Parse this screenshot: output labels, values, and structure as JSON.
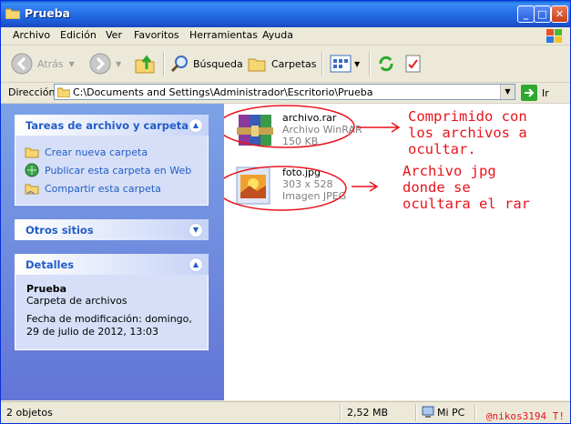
{
  "window": {
    "title": "Prueba"
  },
  "menu": [
    "Archivo",
    "Edición",
    "Ver",
    "Favoritos",
    "Herramientas",
    "Ayuda"
  ],
  "toolbar": {
    "back": "Atrás",
    "search": "Búsqueda",
    "folders": "Carpetas"
  },
  "address": {
    "label": "Dirección",
    "path": "C:\\Documents and Settings\\Administrador\\Escritorio\\Prueba",
    "go": "Ir"
  },
  "tasks_panel": {
    "title": "Tareas de archivo y carpeta",
    "items": [
      "Crear nueva carpeta",
      "Publicar esta carpeta en Web",
      "Compartir esta carpeta"
    ]
  },
  "other_places": {
    "title": "Otros sitios"
  },
  "details": {
    "title": "Detalles",
    "name": "Prueba",
    "type": "Carpeta de archivos",
    "modified": "Fecha de modificación: domingo, 29 de julio de 2012, 13:03"
  },
  "files": [
    {
      "name": "archivo.rar",
      "line2": "Archivo WinRAR",
      "line3": "150 KB"
    },
    {
      "name": "foto.jpg",
      "line2": "303 x 528",
      "line3": "Imagen JPEG"
    }
  ],
  "annotations": {
    "rar": [
      "Comprimido con",
      "los archivos a",
      "ocultar."
    ],
    "jpg": [
      "Archivo jpg",
      "donde se",
      "ocultara el rar"
    ]
  },
  "status": {
    "count": "2 objetos",
    "size": "2,52 MB",
    "location": "Mi PC",
    "watermark": "@nikos3194 T!"
  },
  "colors": {
    "title_blue": "#2870e8",
    "task_link": "#215dc6",
    "annotation_red": "#e8141c"
  }
}
